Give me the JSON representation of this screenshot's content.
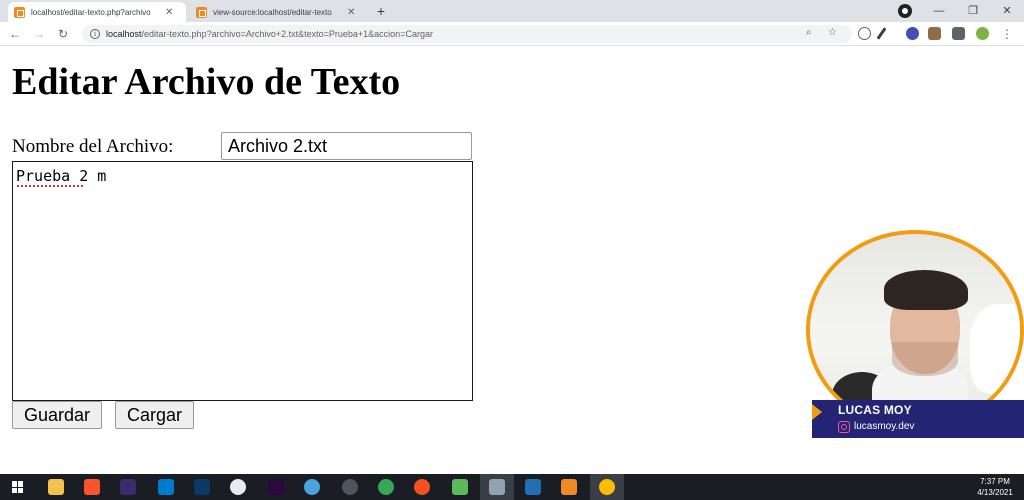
{
  "browser": {
    "tabs": [
      {
        "title": "localhost/editar-texto.php?archivo",
        "active": true
      },
      {
        "title": "view-source:localhost/editar-texto",
        "active": false
      }
    ],
    "new_tab_label": "+",
    "url_host": "localhost",
    "url_path": "/editar-texto.php?archivo=Archivo+2.txt&texto=Prueba+1&accion=Cargar"
  },
  "page": {
    "title": "Editar Archivo de Texto",
    "filename_label": "Nombre del Archivo:",
    "filename_value": "Archivo 2.txt",
    "textarea_value": "Prueba 2 m",
    "buttons": {
      "save": "Guardar",
      "load": "Cargar"
    }
  },
  "webcam": {
    "name": "LUCAS MOY",
    "handle": "lucasmoy.dev"
  },
  "taskbar": {
    "time": "7:37 PM",
    "date": "4/13/2021"
  },
  "colors": {
    "accent_orange": "#f29c12",
    "banner_navy": "#232574",
    "taskbar": "#1a1d24"
  }
}
